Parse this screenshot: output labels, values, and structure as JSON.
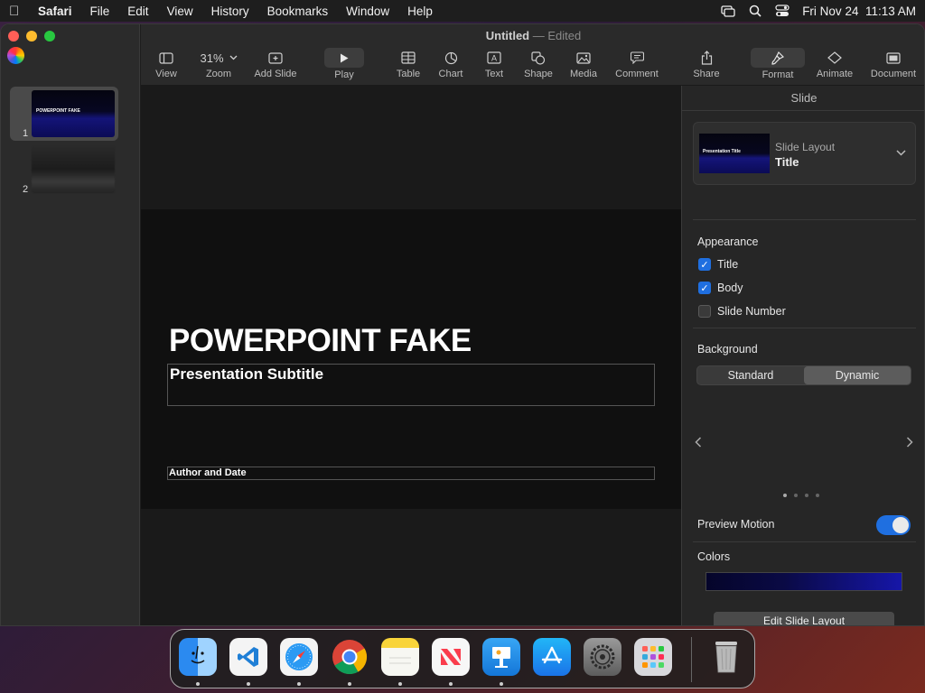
{
  "menubar": {
    "app": "Safari",
    "items": [
      "File",
      "Edit",
      "View",
      "History",
      "Bookmarks",
      "Window",
      "Help"
    ],
    "datetime": "Fri Nov 24  11:13 AM"
  },
  "window": {
    "title": "Untitled",
    "title_sep": "—",
    "status": "Edited"
  },
  "toolbar": {
    "view": "View",
    "zoom_value": "31%",
    "zoom": "Zoom",
    "add_slide": "Add Slide",
    "play": "Play",
    "table": "Table",
    "chart": "Chart",
    "text": "Text",
    "shape": "Shape",
    "media": "Media",
    "comment": "Comment",
    "share": "Share",
    "format": "Format",
    "animate": "Animate",
    "document": "Document"
  },
  "slides": [
    {
      "num": "1",
      "thumb_text": "POWERPOINT FAKE"
    },
    {
      "num": "2"
    }
  ],
  "slide": {
    "title": "POWERPOINT FAKE",
    "subtitle": "Presentation Subtitle",
    "author": "Author and Date"
  },
  "inspector": {
    "header": "Slide",
    "layout_thumb_text": "Presentation Title",
    "layout_label": "Slide Layout",
    "layout_value": "Title",
    "appearance": "Appearance",
    "cb_title": "Title",
    "cb_body": "Body",
    "cb_slide_number": "Slide Number",
    "background": "Background",
    "seg_standard": "Standard",
    "seg_dynamic": "Dynamic",
    "preview_motion": "Preview Motion",
    "colors": "Colors",
    "edit_layout": "Edit Slide Layout"
  },
  "dock": {
    "apps": [
      "Finder",
      "Visual Studio Code",
      "Safari",
      "Google Chrome",
      "Notes",
      "News",
      "Keynote",
      "App Store",
      "System Settings",
      "Launchpad",
      "Trash"
    ]
  }
}
